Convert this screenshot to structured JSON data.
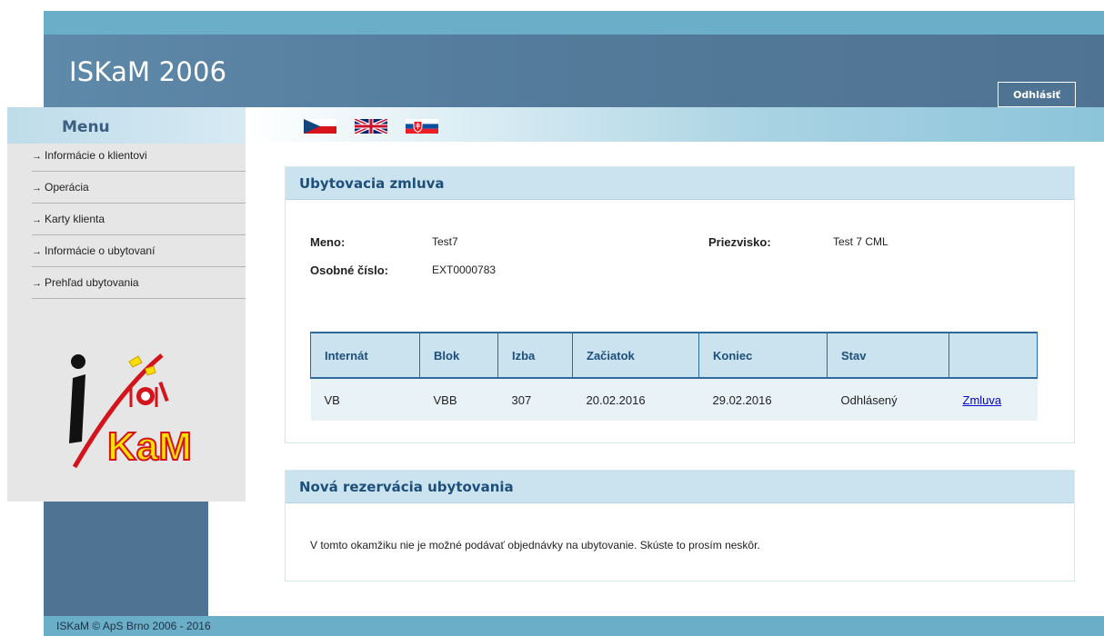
{
  "header": {
    "title": "ISKaM 2006",
    "logout_label": "Odhlásiť"
  },
  "languages": [
    {
      "code": "cz",
      "icon": "czech-flag-icon"
    },
    {
      "code": "gb",
      "icon": "uk-flag-icon"
    },
    {
      "code": "sk",
      "icon": "slovak-flag-icon"
    }
  ],
  "sidebar": {
    "title": "Menu",
    "items": [
      {
        "label": "Informácie o klientovi"
      },
      {
        "label": "Operácia"
      },
      {
        "label": "Karty klienta"
      },
      {
        "label": "Informácie o ubytovaní"
      },
      {
        "label": "Prehľad ubytovania"
      }
    ],
    "logo_text": "KaM"
  },
  "contract": {
    "title": "Ubytovacia zmluva",
    "name_label": "Meno:",
    "name_value": "Test7",
    "surname_label": "Priezvisko:",
    "surname_value": "Test 7 CML",
    "personal_id_label": "Osobné číslo:",
    "personal_id_value": "EXT0000783",
    "table": {
      "columns": [
        "Internát",
        "Blok",
        "Izba",
        "Začiatok",
        "Koniec",
        "Stav",
        ""
      ],
      "rows": [
        [
          "VB",
          "VBB",
          "307",
          "20.02.2016",
          "29.02.2016",
          "Odhlásený",
          "Zmluva"
        ]
      ]
    }
  },
  "new_reservation": {
    "title": "Nová rezervácia ubytovania",
    "message": "V tomto okamžiku nie je možné podávať objednávky na ubytovanie. Skúste to prosím neskôr."
  },
  "footer": {
    "text": "ISKaM © ApS Brno 2006 - 2016"
  },
  "colors": {
    "header": "#4f7393",
    "accent": "#6aaec8",
    "panel_head": "#cae3ee",
    "title_text": "#1e4f7a",
    "link": "#0000cc"
  }
}
